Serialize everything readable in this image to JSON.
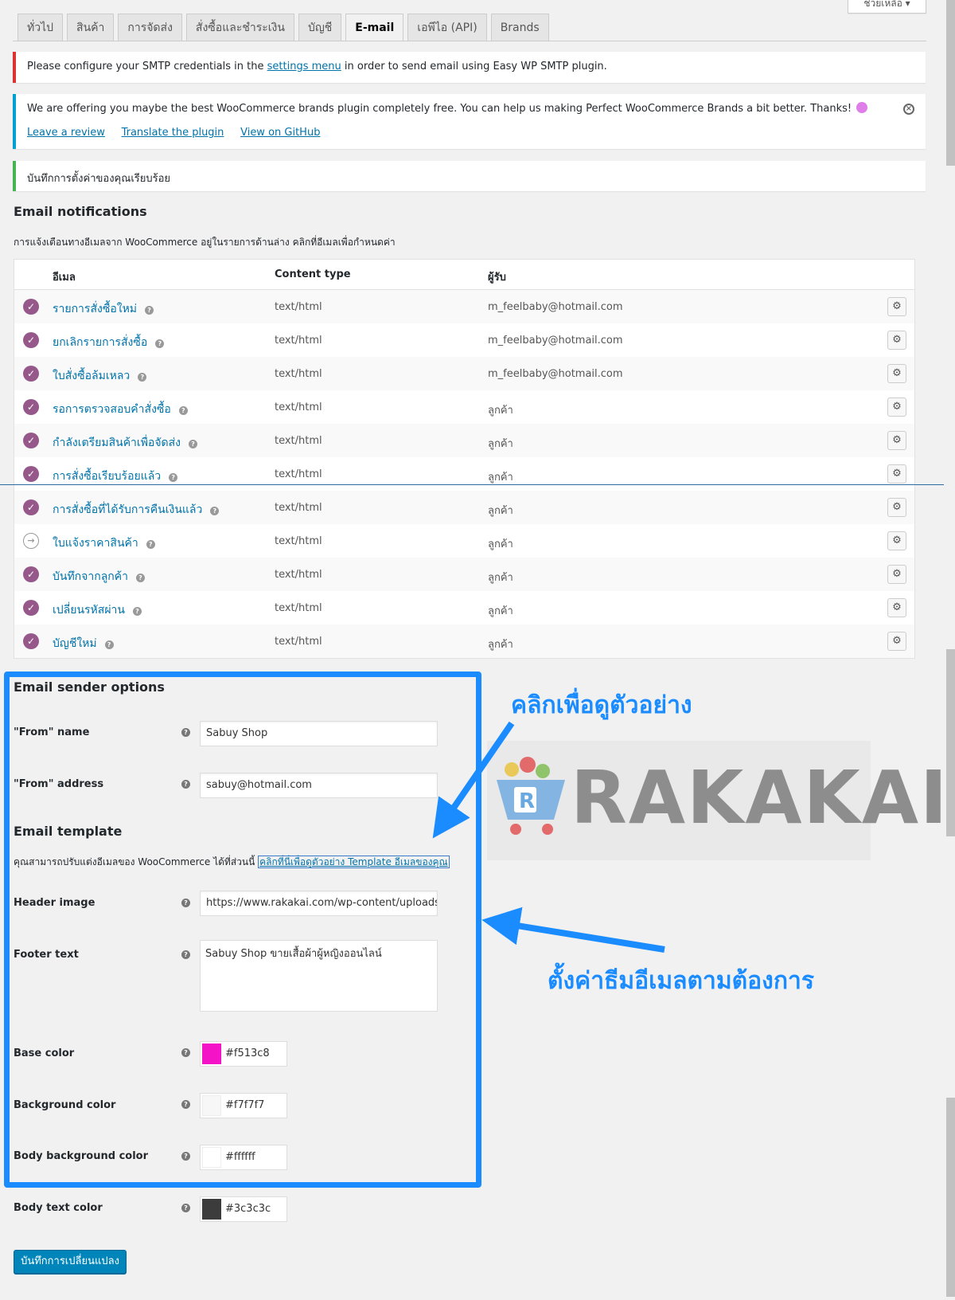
{
  "help_label": "ช่วยเหลือ ▾",
  "tabs": [
    {
      "label": "ทั่วไป"
    },
    {
      "label": "สินค้า"
    },
    {
      "label": "การจัดส่ง"
    },
    {
      "label": "สั่งซื้อและชำระเงิน"
    },
    {
      "label": "บัญชี"
    },
    {
      "label": "E-mail"
    },
    {
      "label": "เอพีไอ (API)"
    },
    {
      "label": "Brands"
    }
  ],
  "notices": {
    "smtp": {
      "before": "Please configure your SMTP credentials in the",
      "link": "settings menu",
      "after": "in order to send email using Easy WP SMTP plugin."
    },
    "brands": {
      "text": "We are offering you maybe the best WooCommerce brands plugin completely free. You can help us making Perfect WooCommerce Brands a bit better. Thanks!",
      "links": [
        "Leave a review",
        "Translate the plugin",
        "View on GitHub"
      ]
    },
    "saved": "บันทึกการตั้งค่าของคุณเรียบร้อย"
  },
  "email_notifications": {
    "title": "Email notifications",
    "description": "การแจ้งเตือนทางอีเมลจาก WooCommerce อยู่ในรายการด้านล่าง คลิกที่อีเมลเพื่อกำหนดค่า",
    "columns": [
      "อีเมล",
      "Content type",
      "ผู้รับ"
    ],
    "rows": [
      {
        "name": "รายการสั่งซื้อใหม่",
        "type": "text/html",
        "recipient": "m_feelbaby@hotmail.com",
        "status": "enabled"
      },
      {
        "name": "ยกเลิกรายการสั่งซื้อ",
        "type": "text/html",
        "recipient": "m_feelbaby@hotmail.com",
        "status": "enabled"
      },
      {
        "name": "ใบสั่งซื้อล้มเหลว",
        "type": "text/html",
        "recipient": "m_feelbaby@hotmail.com",
        "status": "enabled"
      },
      {
        "name": "รอการตรวจสอบคำสั่งซื้อ",
        "type": "text/html",
        "recipient": "ลูกค้า",
        "status": "enabled"
      },
      {
        "name": "กำลังเตรียมสินค้าเพื่อจัดส่ง",
        "type": "text/html",
        "recipient": "ลูกค้า",
        "status": "enabled"
      },
      {
        "name": "การสั่งซื้อเรียบร้อยแล้ว",
        "type": "text/html",
        "recipient": "ลูกค้า",
        "status": "enabled"
      },
      {
        "name": "การสั่งซื้อที่ได้รับการคืนเงินแล้ว",
        "type": "text/html",
        "recipient": "ลูกค้า",
        "status": "enabled"
      },
      {
        "name": "ใบแจ้งราคาสินค้า",
        "type": "text/html",
        "recipient": "ลูกค้า",
        "status": "manual"
      },
      {
        "name": "บันทึกจากลูกค้า",
        "type": "text/html",
        "recipient": "ลูกค้า",
        "status": "enabled"
      },
      {
        "name": "เปลี่ยนรหัสผ่าน",
        "type": "text/html",
        "recipient": "ลูกค้า",
        "status": "enabled"
      },
      {
        "name": "บัญชีใหม่",
        "type": "text/html",
        "recipient": "ลูกค้า",
        "status": "enabled"
      }
    ]
  },
  "sender": {
    "title": "Email sender options",
    "from_name_label": "\"From\" name",
    "from_name_value": "Sabuy Shop",
    "from_address_label": "\"From\" address",
    "from_address_value": "sabuy@hotmail.com"
  },
  "template": {
    "title": "Email template",
    "description": "คุณสามารถปรับแต่งอีเมลของ WooCommerce ได้ที่ส่วนนี้",
    "preview_link": "คลิกที่นี่เพื่อดูตัวอย่าง Template อีเมลของคุณ",
    "header_image_label": "Header image",
    "header_image_value": "https://www.rakakai.com/wp-content/uploads/.",
    "footer_text_label": "Footer text",
    "footer_text_value": "Sabuy Shop ขายเสื้อผ้าผู้หญิงออนไลน์",
    "colors": [
      {
        "label": "Base color",
        "value": "#f513c8",
        "swatch": "#f513c8"
      },
      {
        "label": "Background color",
        "value": "#f7f7f7",
        "swatch": "#f7f7f7"
      },
      {
        "label": "Body background color",
        "value": "#ffffff",
        "swatch": "#ffffff"
      },
      {
        "label": "Body text color",
        "value": "#3c3c3c",
        "swatch": "#3c3c3c"
      }
    ]
  },
  "save_button": "บันทึกการเปลี่ยนแปลง",
  "annotations": {
    "preview_hint": "คลิกเพื่อดูตัวอย่าง",
    "theme_hint": "ตั้งค่าธีมอีเมลตามต้องการ",
    "watermark": "RAKAKAI",
    "accent_color": "#1a8cff"
  }
}
